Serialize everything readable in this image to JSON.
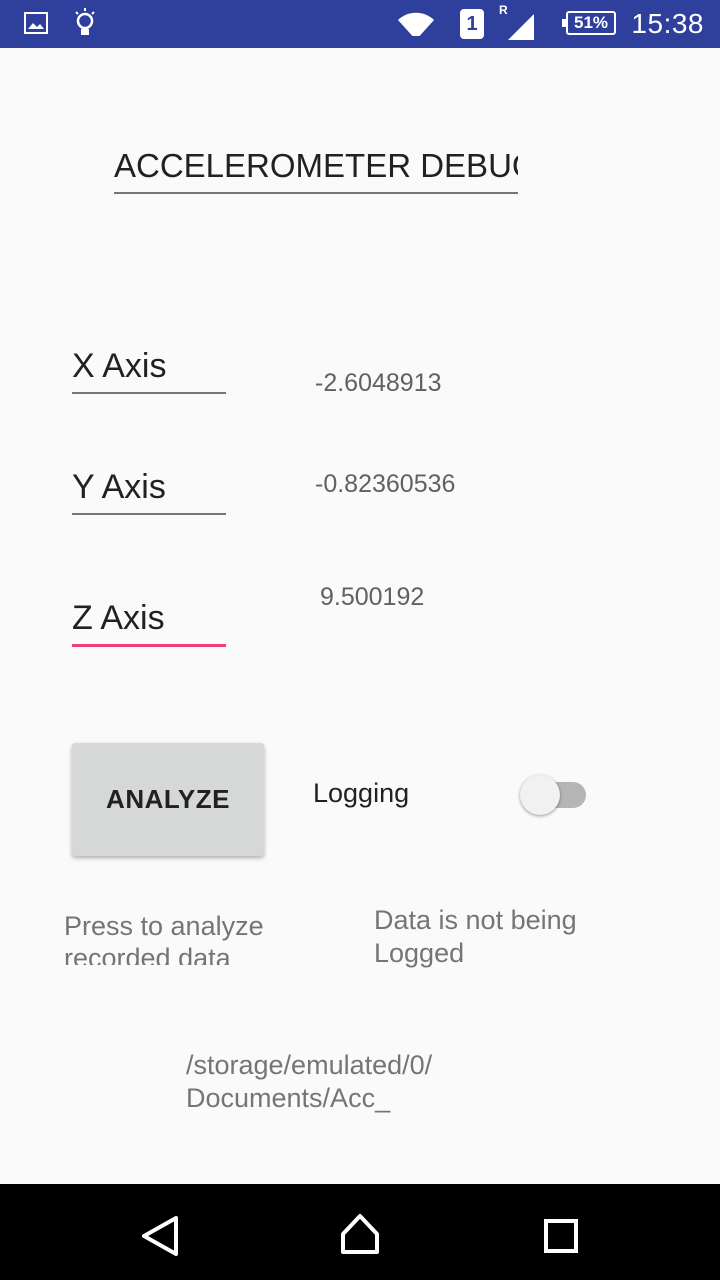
{
  "status_bar": {
    "time": "15:38",
    "battery": "51%",
    "sim_slot": "1",
    "roaming": "R",
    "icons": [
      "gallery-icon",
      "lightbulb-icon",
      "wifi-icon",
      "sim-icon",
      "signal-icon",
      "battery-icon"
    ],
    "color": "#2e3f9c"
  },
  "title_field": {
    "value": "ACCELEROMETER DEBUG"
  },
  "axes": [
    {
      "label": "X Axis",
      "value": "-2.6048913"
    },
    {
      "label": "Y Axis",
      "value": "-0.82360536"
    },
    {
      "label": "Z Axis",
      "value": "9.500192"
    }
  ],
  "analyze_button": {
    "label": "ANALYZE"
  },
  "logging": {
    "label": "Logging",
    "enabled": false
  },
  "analyze_hint": "Press to analyze recorded data",
  "logging_status": "Data is not being Logged",
  "file_path": "/storage/emulated/0/Documents/Acc_",
  "accent_color": "#ec407a",
  "nav_bar": {
    "icons": [
      "back-icon",
      "home-icon",
      "recents-icon"
    ]
  }
}
